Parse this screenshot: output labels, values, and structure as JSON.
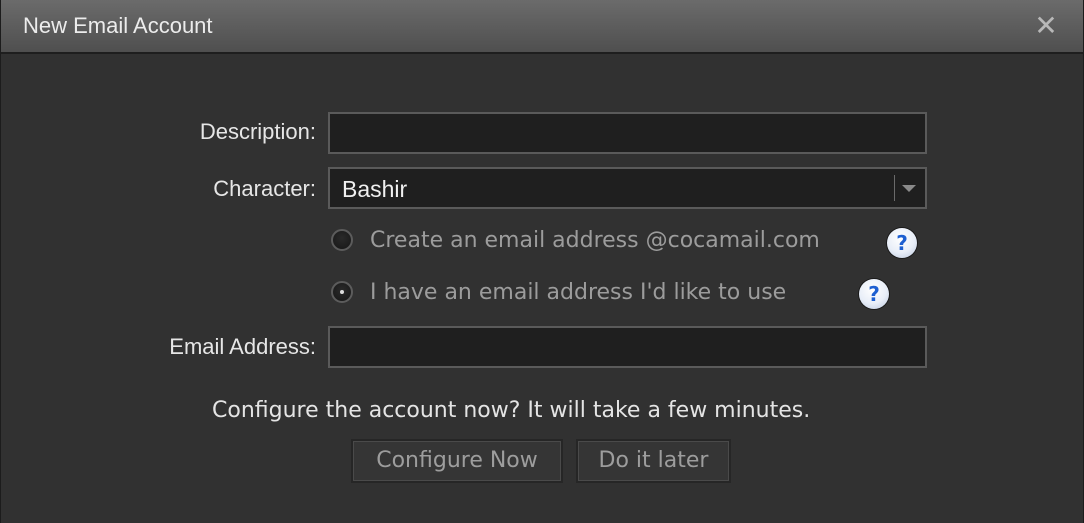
{
  "dialog": {
    "title": "New Email Account",
    "close_glyph": "✕"
  },
  "form": {
    "description_label": "Description:",
    "description_value": "",
    "character_label": "Character:",
    "character_value": "Bashir",
    "radio_create_label": "Create an email address @cocamail.com",
    "radio_create_checked": false,
    "radio_existing_label": "I have an email address I'd like to use",
    "radio_existing_checked": true,
    "help_glyph": "?",
    "email_label": "Email Address:",
    "email_value": ""
  },
  "configure": {
    "prompt": "Configure the account now? It will take a few minutes.",
    "configure_now_label": "Configure Now",
    "later_label": "Do it later"
  },
  "icons": {
    "close": "close-icon",
    "help": "help-icon",
    "dropdown": "chevron-down-icon"
  },
  "colors": {
    "dialog_bg": "#313131",
    "titlebar_top": "#6b6b6b",
    "titlebar_bottom": "#4f4f4f",
    "field_bg": "#1f1f1f",
    "help_accent": "#1d5fd1"
  }
}
